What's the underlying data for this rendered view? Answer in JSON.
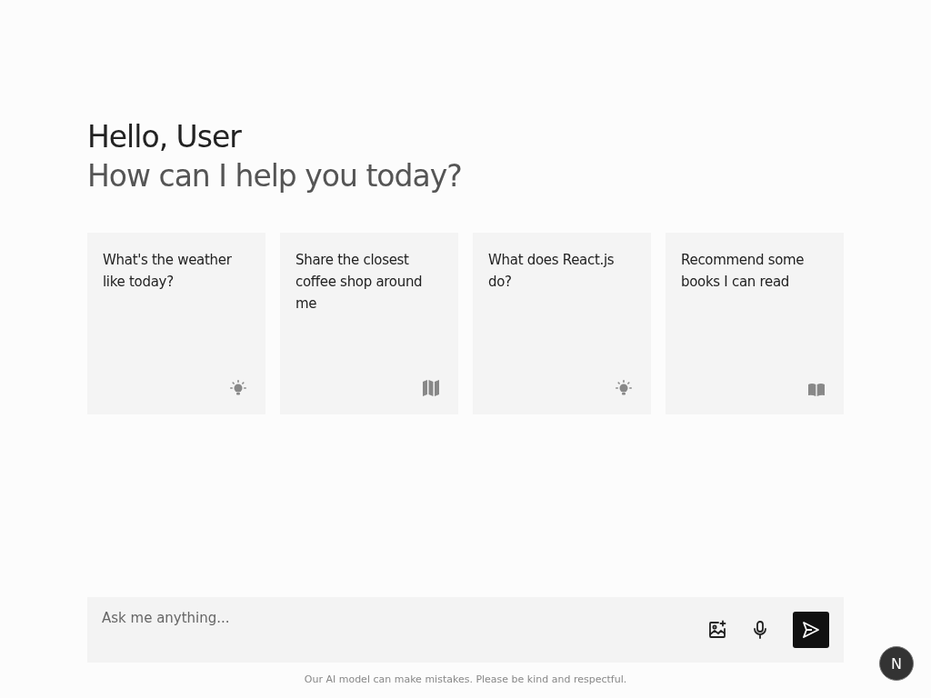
{
  "greeting": {
    "title": "Hello, User",
    "subtitle": "How can I help you today?"
  },
  "suggestions": [
    {
      "text": "What's the weather like today?",
      "kind": "bulb"
    },
    {
      "text": "Share the closest coffee shop around me",
      "kind": "map"
    },
    {
      "text": "What does React.js do?",
      "kind": "bulb"
    },
    {
      "text": "Recommend some books I can read",
      "kind": "book"
    }
  ],
  "composer": {
    "placeholder": "Ask me anything..."
  },
  "disclaimer": "Our AI model can make mistakes. Please be kind and respectful.",
  "dev_badge": "N"
}
